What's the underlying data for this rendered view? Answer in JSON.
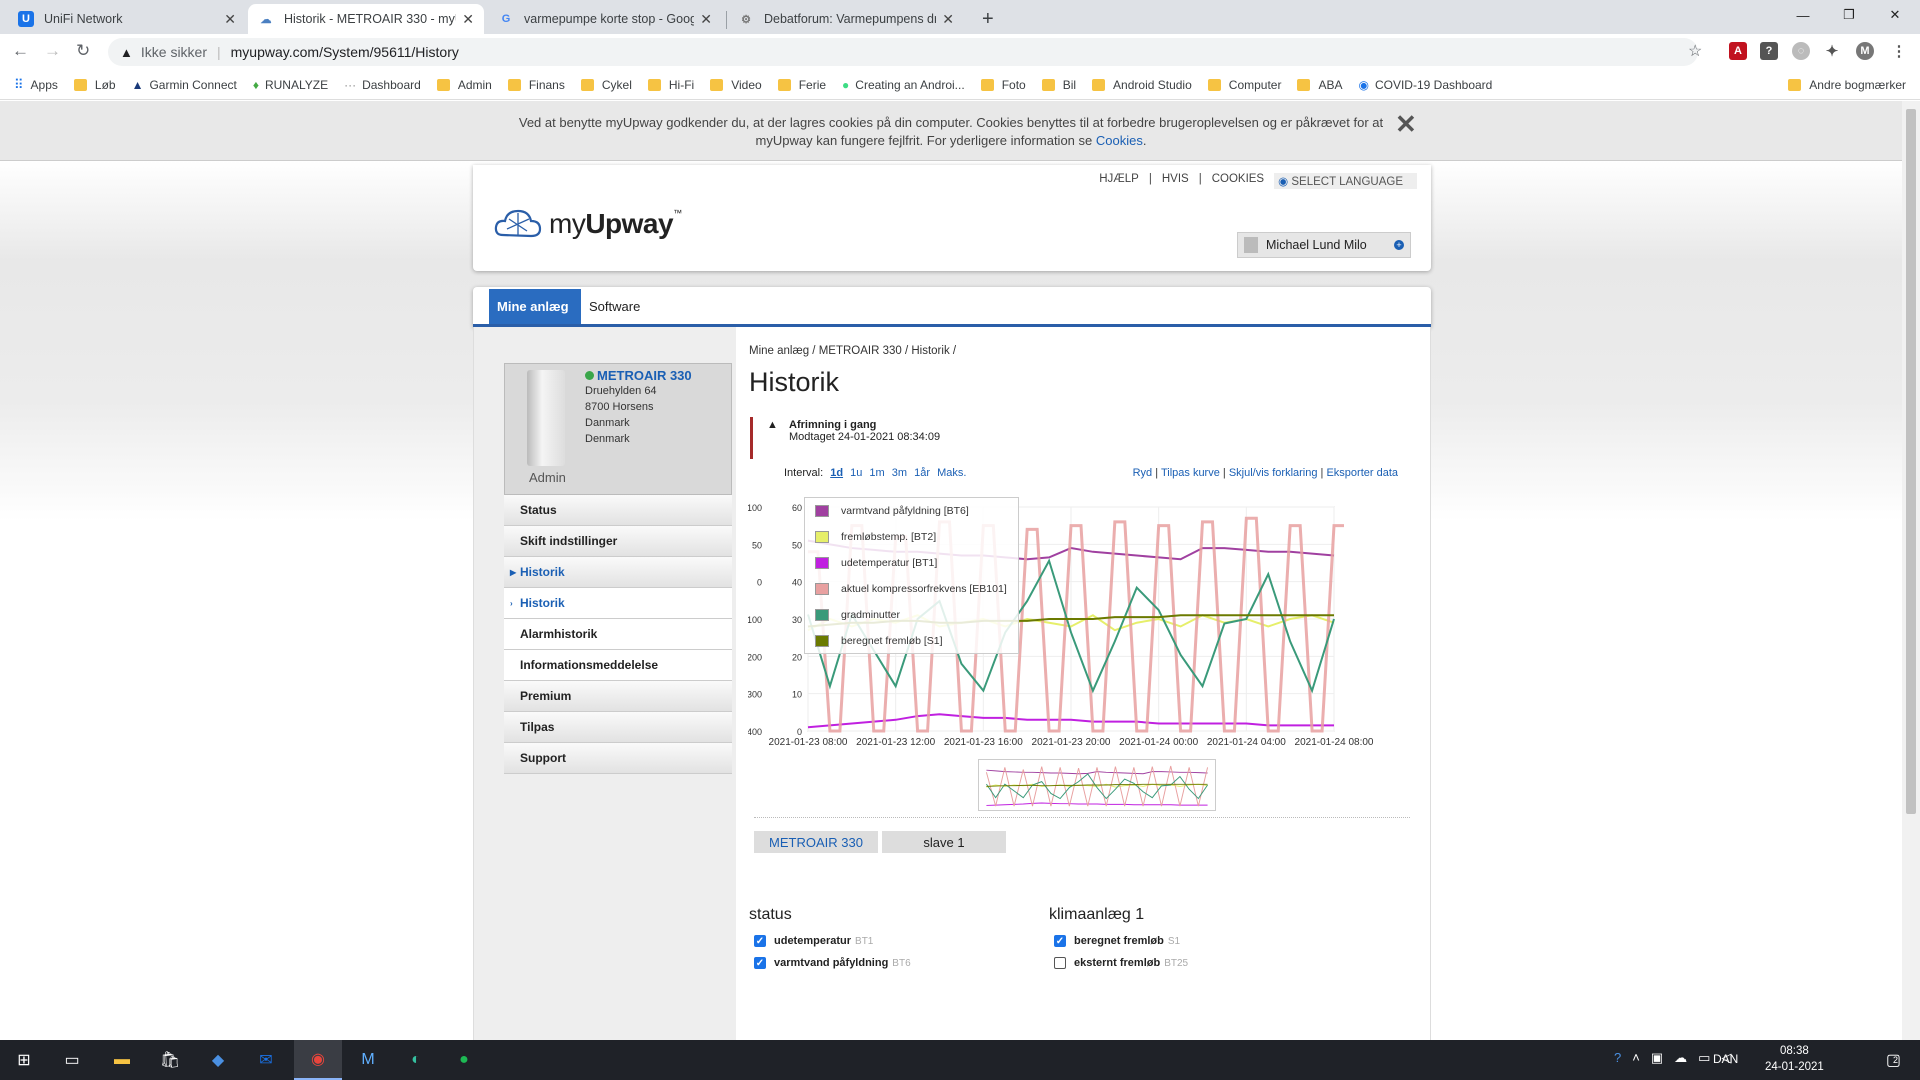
{
  "browser": {
    "tabs": [
      {
        "title": "UniFi Network",
        "icon": "unifi-icon"
      },
      {
        "title": "Historik - METROAIR 330 - myUp",
        "icon": "cloud-icon"
      },
      {
        "title": "varmepumpe korte stop - Googl",
        "icon": "google-icon"
      },
      {
        "title": "Debatforum: Varmepumpens dri",
        "icon": "forum-icon"
      }
    ],
    "security_label": "Ikke sikker",
    "url": "myupway.com/System/95611/History",
    "profile_initial": "M",
    "bookmarks": [
      "Apps",
      "Løb",
      "Garmin Connect",
      "RUNALYZE",
      "Dashboard",
      "Admin",
      "Finans",
      "Cykel",
      "Hi-Fi",
      "Video",
      "Ferie",
      "Creating an Androi...",
      "Foto",
      "Bil",
      "Android Studio",
      "Computer",
      "ABA",
      "COVID-19 Dashboard"
    ],
    "other_bookmarks": "Andre bogmærker"
  },
  "cookie": {
    "line1": "Ved at benytte myUpway godkender du, at der lagres cookies på din computer. Cookies benyttes til at forbedre brugeroplevelsen og er påkrævet for at",
    "line2": "myUpway kan fungere fejlfrit. For yderligere information se ",
    "link": "Cookies",
    "end": "."
  },
  "header": {
    "links": [
      "HJÆLP",
      "HVIS",
      "COOKIES"
    ],
    "language": "SELECT LANGUAGE",
    "logo_prefix": "my",
    "logo_bold": "Upway",
    "logo_tm": "™",
    "user": "Michael Lund Milo"
  },
  "mainnav": {
    "tabs": [
      "Mine anlæg",
      "Software"
    ]
  },
  "device": {
    "name": "METROAIR 330",
    "address": [
      "Druehylden 64",
      "8700 Horsens",
      "Danmark",
      "Denmark"
    ],
    "role": "Admin"
  },
  "menu": [
    "Status",
    "Skift indstillinger",
    "Historik",
    "Historik",
    "Alarmhistorik",
    "Informationsmeddelelse",
    "Premium",
    "Tilpas",
    "Support"
  ],
  "breadcrumb": [
    "Mine anlæg",
    "METROAIR 330",
    "Historik"
  ],
  "page_title": "Historik",
  "alarm": {
    "title": "Afrimning i gang",
    "received": "Modtaget 24-01-2021 08:34:09"
  },
  "interval": {
    "label": "Interval:",
    "options": [
      "1d",
      "1u",
      "1m",
      "3m",
      "1år",
      "Maks."
    ],
    "selected": "1d"
  },
  "actions": [
    "Ryd",
    "Tilpas kurve",
    "Skjul/vis forklaring",
    "Eksporter data"
  ],
  "chart_data": {
    "type": "line",
    "x_labels": [
      "2021-01-23 08:00",
      "2021-01-23 12:00",
      "2021-01-23 16:00",
      "2021-01-23 20:00",
      "2021-01-24 00:00",
      "2021-01-24 04:00",
      "2021-01-24 08:00"
    ],
    "x": [
      0,
      1,
      2,
      3,
      4,
      5,
      6,
      7,
      8,
      9,
      10,
      11,
      12,
      13,
      14,
      15,
      16,
      17,
      18,
      19,
      20,
      21,
      22,
      23,
      24
    ],
    "left_axis": {
      "ticks": [
        100,
        50,
        0,
        -100,
        -200,
        -300,
        -400
      ]
    },
    "right_axis": {
      "ticks": [
        60,
        50,
        40,
        30,
        20,
        10,
        0
      ],
      "ylim": [
        0,
        60
      ]
    },
    "series": [
      {
        "name": "varmtvand påfyldning [BT6]",
        "color": "#a040a0",
        "values": [
          51,
          50,
          49,
          48.5,
          48,
          48,
          47.5,
          47,
          47,
          46.5,
          46,
          46.5,
          49,
          48,
          47.5,
          47,
          46.5,
          46,
          49,
          49,
          48.5,
          48,
          48,
          47.5,
          47
        ]
      },
      {
        "name": "fremløbstemp. [BT2]",
        "color": "#e6ef6a",
        "values": [
          27,
          30,
          28,
          30,
          29,
          31,
          28,
          29,
          30,
          28,
          30,
          29,
          28,
          31,
          27,
          29,
          30,
          28,
          31,
          29,
          30,
          28,
          30,
          31,
          29
        ]
      },
      {
        "name": "udetemperatur [BT1]",
        "color": "#c020e0",
        "values": [
          1,
          1.5,
          2,
          2.5,
          3,
          4,
          4.5,
          4,
          3.5,
          3.5,
          3,
          3,
          3,
          2.5,
          2.5,
          2.5,
          2,
          2,
          2,
          2,
          2,
          1.5,
          1.5,
          1.5,
          1.5
        ]
      },
      {
        "name": "aktuel kompressorfrekvens [EB101]",
        "color": "#e8a0a0",
        "values": [
          48,
          0,
          55,
          0,
          52,
          0,
          56,
          0,
          55,
          0,
          54,
          0,
          55,
          0,
          56,
          0,
          55,
          0,
          56,
          0,
          57,
          0,
          55,
          0,
          55
        ]
      },
      {
        "name": "gradminutter",
        "color": "#3a9a7a",
        "values": [
          -140,
          -300,
          -140,
          -220,
          -300,
          -150,
          -110,
          -250,
          -310,
          -180,
          -110,
          -20,
          -180,
          -310,
          -200,
          -80,
          -130,
          -230,
          -300,
          -160,
          -150,
          -50,
          -200,
          -310,
          -150
        ]
      },
      {
        "name": "beregnet fremløb [S1]",
        "color": "#6b7a00",
        "values": [
          28,
          28.5,
          29,
          29,
          29.5,
          29.5,
          29,
          29,
          29.5,
          29.5,
          29.5,
          30,
          30,
          30,
          30.5,
          30.5,
          30.5,
          31,
          31,
          31,
          31,
          31,
          31,
          31,
          31
        ]
      }
    ]
  },
  "units": [
    "METROAIR 330",
    "slave 1"
  ],
  "sections": {
    "status": {
      "title": "status",
      "items": [
        {
          "label": "udetemperatur",
          "code": "BT1",
          "checked": true
        },
        {
          "label": "varmtvand påfyldning",
          "code": "BT6",
          "checked": true
        }
      ]
    },
    "klima": {
      "title": "klimaanlæg 1",
      "items": [
        {
          "label": "beregnet fremløb",
          "code": "S1",
          "checked": true
        },
        {
          "label": "eksternt fremløb",
          "code": "BT25",
          "checked": false
        }
      ]
    }
  },
  "taskbar": {
    "lang": "DAN",
    "time": "08:38",
    "date": "24-01-2021",
    "notifications": "2"
  }
}
